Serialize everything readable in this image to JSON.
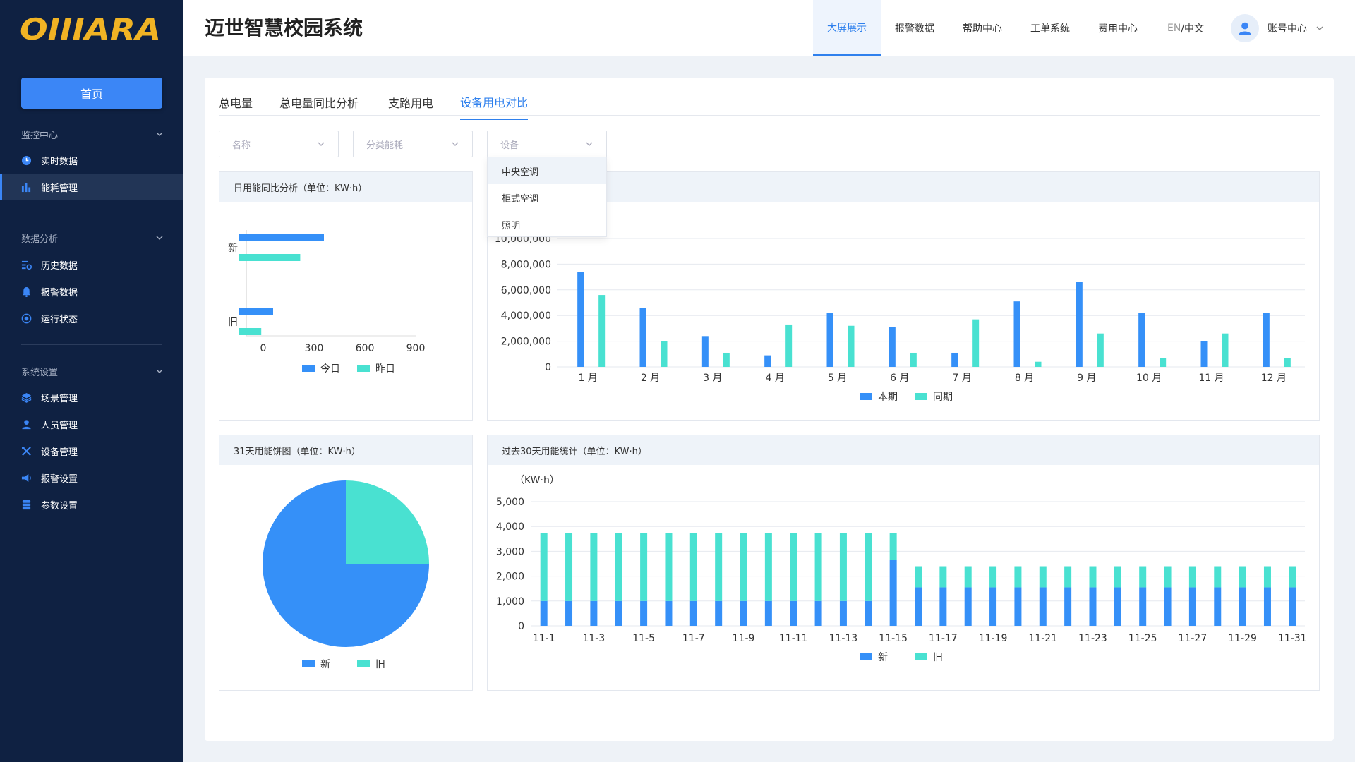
{
  "brand": {
    "logo_text": "OIIIARA",
    "logo_color": "#f0b324"
  },
  "app": {
    "title": "迈世智慧校园系统"
  },
  "colors": {
    "sidebar_bg": "#0f2142",
    "accent": "#3b86f6",
    "series_a": "#3590f8",
    "series_b": "#49e1d1"
  },
  "sidebar": {
    "home_label": "首页",
    "sections": [
      {
        "title": "监控中心",
        "items": [
          {
            "label": "实时数据",
            "icon": "clock-icon"
          },
          {
            "label": "能耗管理",
            "icon": "bar-chart-icon",
            "active": true
          }
        ]
      },
      {
        "title": "数据分析",
        "items": [
          {
            "label": "历史数据",
            "icon": "history-icon"
          },
          {
            "label": "报警数据",
            "icon": "bell-icon"
          },
          {
            "label": "运行状态",
            "icon": "status-icon"
          }
        ]
      },
      {
        "title": "系统设置",
        "items": [
          {
            "label": "场景管理",
            "icon": "layers-icon"
          },
          {
            "label": "人员管理",
            "icon": "user-icon"
          },
          {
            "label": "设备管理",
            "icon": "tools-icon"
          },
          {
            "label": "报警设置",
            "icon": "speaker-icon"
          },
          {
            "label": "参数设置",
            "icon": "database-icon"
          }
        ]
      }
    ]
  },
  "topnav": {
    "items": [
      "大屏展示",
      "报警数据",
      "帮助中心",
      "工单系统",
      "费用中心"
    ],
    "active": "大屏展示",
    "lang_en": "EN",
    "lang_zh": "/中文",
    "account": "账号中心"
  },
  "tabs": {
    "items": [
      "总电量",
      "总电量同比分析",
      "支路用电",
      "设备用电对比"
    ],
    "active": "设备用电对比"
  },
  "filters": {
    "name_placeholder": "名称",
    "category_placeholder": "分类能耗",
    "device_placeholder": "设备"
  },
  "dropdown": {
    "options": [
      "中央空调",
      "柜式空调",
      "照明"
    ],
    "hovered": "中央空调"
  },
  "chart_data": [
    {
      "type": "bar",
      "orientation": "horizontal",
      "title": "日用能同比分析（单位：KW·h）",
      "categories": [
        "新",
        "旧"
      ],
      "series": [
        {
          "name": "今日",
          "values": [
            400,
            100
          ]
        },
        {
          "name": "昨日",
          "values": [
            260,
            30
          ]
        }
      ],
      "xlim": [
        -100,
        900
      ],
      "xticks": [
        "0",
        "300",
        "600",
        "900"
      ]
    },
    {
      "type": "bar",
      "title": "",
      "categories": [
        "1 月",
        "2 月",
        "3 月",
        "4 月",
        "5 月",
        "6 月",
        "7 月",
        "8 月",
        "9 月",
        "10 月",
        "11 月",
        "12 月"
      ],
      "series": [
        {
          "name": "本期",
          "values": [
            7400000,
            4600000,
            2400000,
            900000,
            4200000,
            3100000,
            1100000,
            5100000,
            6600000,
            4200000,
            2000000,
            4200000
          ]
        },
        {
          "name": "同期",
          "values": [
            5600000,
            2000000,
            1100000,
            3300000,
            3200000,
            1100000,
            3700000,
            400000,
            2600000,
            700000,
            2600000,
            700000
          ]
        }
      ],
      "ylim": [
        0,
        10000000
      ],
      "yticks": [
        "0",
        "2,000,000",
        "4,000,000",
        "6,000,000",
        "8,000,000",
        "10,000,000"
      ]
    },
    {
      "type": "pie",
      "title": "31天用能饼图（单位：KW·h）",
      "slices": [
        {
          "name": "新",
          "value": 75
        },
        {
          "name": "旧",
          "value": 25
        }
      ]
    },
    {
      "type": "bar",
      "stacked": true,
      "title": "过去30天用能统计（单位：KW·h）",
      "ylabel": "（KW·h）",
      "categories": [
        "11-1",
        "11-2",
        "11-3",
        "11-4",
        "11-5",
        "11-6",
        "11-7",
        "11-8",
        "11-9",
        "11-10",
        "11-11",
        "11-12",
        "11-13",
        "11-14",
        "11-15",
        "11-16",
        "11-17",
        "11-18",
        "11-19",
        "11-20",
        "11-21",
        "11-22",
        "11-23",
        "11-24",
        "11-25",
        "11-26",
        "11-27",
        "11-28",
        "11-29",
        "11-30",
        "11-31"
      ],
      "xtick_labels": [
        "11-1",
        "11-3",
        "11-5",
        "11-7",
        "11-9",
        "11-11",
        "11-13",
        "11-15",
        "11-17",
        "11-19",
        "11-21",
        "11-23",
        "11-25",
        "11-27",
        "11-29",
        "11-31"
      ],
      "series": [
        {
          "name": "新",
          "values": [
            1000,
            1000,
            1000,
            1000,
            1000,
            1000,
            1000,
            1000,
            1000,
            1000,
            1000,
            1000,
            1000,
            1000,
            2650,
            1550,
            1550,
            1550,
            1550,
            1550,
            1550,
            1550,
            1550,
            1550,
            1550,
            1550,
            1550,
            1550,
            1550,
            1550,
            1550
          ]
        },
        {
          "name": "旧",
          "values": [
            2750,
            2750,
            2750,
            2750,
            2750,
            2750,
            2750,
            2750,
            2750,
            2750,
            2750,
            2750,
            2750,
            2750,
            1100,
            850,
            850,
            850,
            850,
            850,
            850,
            850,
            850,
            850,
            850,
            850,
            850,
            850,
            850,
            850,
            850
          ]
        }
      ],
      "ylim": [
        0,
        5000
      ],
      "yticks": [
        "0",
        "1,000",
        "2,000",
        "3,000",
        "4,000",
        "5,000"
      ]
    }
  ]
}
